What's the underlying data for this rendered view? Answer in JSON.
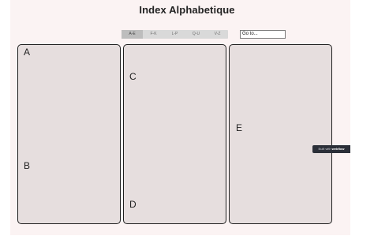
{
  "header": {
    "title": "Index Alphabetique"
  },
  "tabs": [
    {
      "label": "A-E",
      "active": true
    },
    {
      "label": "F-K",
      "active": false
    },
    {
      "label": "L-P",
      "active": false
    },
    {
      "label": "Q-U",
      "active": false
    },
    {
      "label": "V-Z",
      "active": false
    }
  ],
  "goto": {
    "value": "Go to..."
  },
  "letters": [
    "A",
    "B",
    "C",
    "D",
    "E"
  ],
  "badge": {
    "prefix": "Built with",
    "brand": "webflow"
  },
  "colors": {
    "stage_background": "#fbf3f3",
    "column_background": "#e6dede",
    "column_border": "#1f1f1f",
    "badge_background": "#2b2f38"
  }
}
